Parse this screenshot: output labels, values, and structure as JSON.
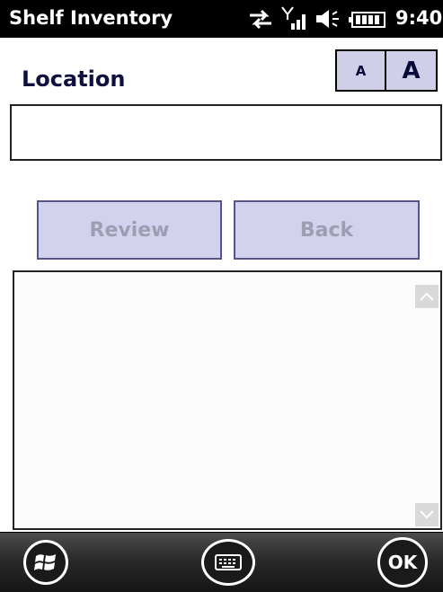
{
  "status_bar": {
    "app_title": "Shelf Inventory",
    "time": "9:40",
    "icons": [
      "data-sync-icon",
      "signal-icon",
      "volume-icon",
      "battery-icon"
    ]
  },
  "header": {
    "label": "Location",
    "font_small_label": "A",
    "font_large_label": "A"
  },
  "location_input": {
    "value": "",
    "placeholder": ""
  },
  "buttons": {
    "review_label": "Review",
    "back_label": "Back"
  },
  "list": {
    "items": []
  },
  "bottom_bar": {
    "start_icon": "windows-start-icon",
    "keyboard_icon": "keyboard-icon",
    "ok_label": "OK"
  },
  "colors": {
    "button_fill": "#d2d2ee",
    "button_text_disabled": "#9e9eb2",
    "label_text": "#101040",
    "status_bar": "#000000"
  }
}
